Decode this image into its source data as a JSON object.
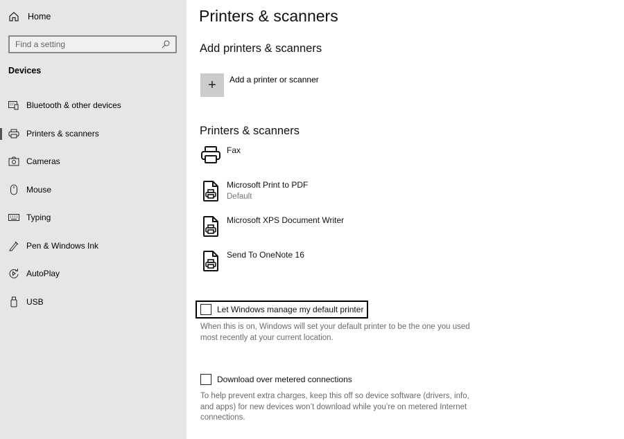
{
  "sidebar": {
    "home_label": "Home",
    "search_placeholder": "Find a setting",
    "section_title": "Devices",
    "items": [
      {
        "label": "Bluetooth & other devices",
        "icon": "bluetooth-devices-icon",
        "selected": false
      },
      {
        "label": "Printers & scanners",
        "icon": "printer-icon",
        "selected": true
      },
      {
        "label": "Cameras",
        "icon": "camera-icon",
        "selected": false
      },
      {
        "label": "Mouse",
        "icon": "mouse-icon",
        "selected": false
      },
      {
        "label": "Typing",
        "icon": "keyboard-icon",
        "selected": false
      },
      {
        "label": "Pen & Windows Ink",
        "icon": "pen-icon",
        "selected": false
      },
      {
        "label": "AutoPlay",
        "icon": "autoplay-icon",
        "selected": false
      },
      {
        "label": "USB",
        "icon": "usb-icon",
        "selected": false
      }
    ]
  },
  "main": {
    "title": "Printers & scanners",
    "add_section": {
      "heading": "Add printers & scanners",
      "button_symbol": "+",
      "button_label": "Add a printer or scanner"
    },
    "list_section": {
      "heading": "Printers & scanners",
      "printers": [
        {
          "name": "Fax",
          "status": "",
          "icon": "printer-icon"
        },
        {
          "name": "Microsoft Print to PDF",
          "status": "Default",
          "icon": "document-printer-icon"
        },
        {
          "name": "Microsoft XPS Document Writer",
          "status": "",
          "icon": "document-printer-icon"
        },
        {
          "name": "Send To OneNote 16",
          "status": "",
          "icon": "document-printer-icon"
        }
      ]
    },
    "manage_default": {
      "label": "Let Windows manage my default printer",
      "checked": false,
      "description": "When this is on, Windows will set your default printer to be the one you used most recently at your current location."
    },
    "metered": {
      "label": "Download over metered connections",
      "checked": false,
      "description": "To help prevent extra charges, keep this off so device software (drivers, info, and apps) for new devices won’t download while you’re on metered Internet connections."
    }
  }
}
